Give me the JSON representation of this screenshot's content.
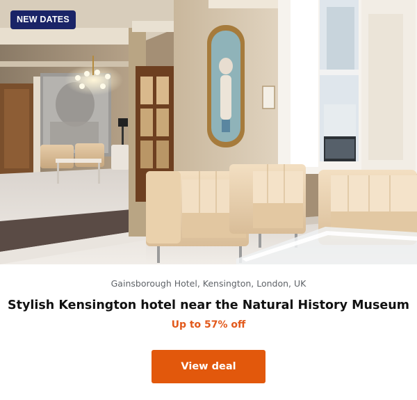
{
  "badge": {
    "label": "NEW DATES"
  },
  "hotel": {
    "location": "Gainsborough Hotel, Kensington, London, UK",
    "title": "Stylish Kensington hotel near the Natural History Museum",
    "offer": "Up to 57% off"
  },
  "cta": {
    "label": "View deal"
  },
  "colors": {
    "badge_bg": "#1a2467",
    "accent": "#e2580c",
    "offer_text": "#e2591b"
  }
}
